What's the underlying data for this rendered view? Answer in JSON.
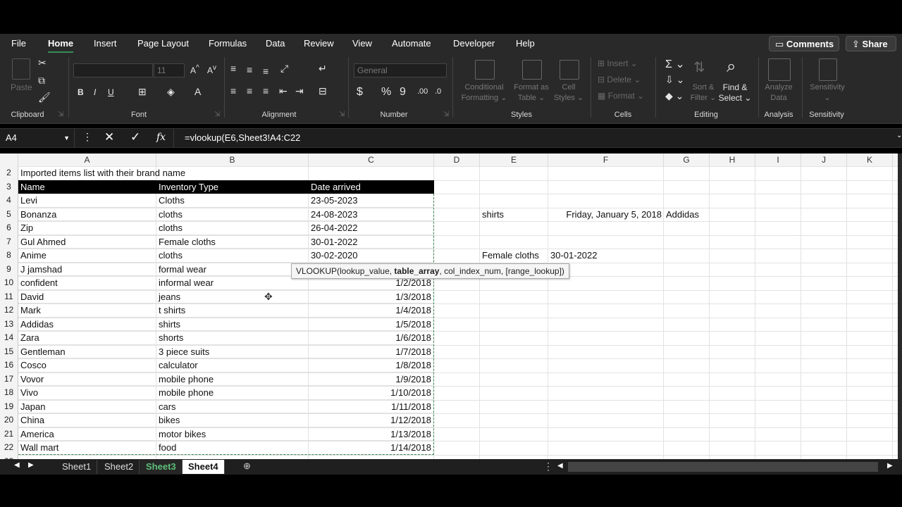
{
  "menu": {
    "items": [
      "File",
      "Home",
      "Insert",
      "Page Layout",
      "Formulas",
      "Data",
      "Review",
      "View",
      "Automate",
      "Developer",
      "Help"
    ],
    "active": "Home",
    "comments_label": "Comments",
    "share_label": "Share"
  },
  "ribbon": {
    "clipboard": {
      "label": "Clipboard",
      "paste": "Paste"
    },
    "font": {
      "label": "Font",
      "size": "11"
    },
    "alignment": {
      "label": "Alignment"
    },
    "number": {
      "label": "Number",
      "format": "General"
    },
    "styles": {
      "label": "Styles",
      "conditional_1": "Conditional",
      "conditional_2": "Formatting",
      "format_as_1": "Format as",
      "format_as_2": "Table",
      "cell_styles_1": "Cell",
      "cell_styles_2": "Styles"
    },
    "cells": {
      "label": "Cells",
      "insert": "Insert",
      "delete": "Delete",
      "format": "Format"
    },
    "editing": {
      "label": "Editing",
      "sort_1": "Sort &",
      "sort_2": "Filter",
      "find_1": "Find &",
      "find_2": "Select"
    },
    "analysis": {
      "label": "Analysis",
      "analyze_1": "Analyze",
      "analyze_2": "Data"
    },
    "sensitivity": {
      "label": "Sensitivity",
      "btn": "Sensitivity"
    }
  },
  "formula_bar": {
    "name_box": "A4",
    "formula": "=vlookup(E6,Sheet3!A4:C22",
    "fx": "fx"
  },
  "tooltip": {
    "prefix": "VLOOKUP(lookup_value, ",
    "bold": "table_array",
    "suffix": ", col_index_num, [range_lookup])"
  },
  "columns": [
    "A",
    "B",
    "C",
    "D",
    "E",
    "F",
    "G",
    "H",
    "I",
    "J",
    "K"
  ],
  "sheet": {
    "title": "Imported items list with their brand name",
    "headers": [
      "Name",
      "Inventory  Type",
      "Date arrived"
    ],
    "rows": [
      {
        "r": "4",
        "a": "Levi",
        "b": "Cloths",
        "c": "23-05-2023"
      },
      {
        "r": "5",
        "a": "Bonanza",
        "b": "cloths",
        "c": "24-08-2023"
      },
      {
        "r": "6",
        "a": "Zip",
        "b": "cloths",
        "c": "26-04-2022"
      },
      {
        "r": "7",
        "a": "Gul Ahmed",
        "b": "Female cloths",
        "c": "30-01-2022"
      },
      {
        "r": "8",
        "a": "Anime",
        "b": "cloths",
        "c": "30-02-2020"
      },
      {
        "r": "9",
        "a": "J jamshad",
        "b": " formal wear",
        "c": ""
      },
      {
        "r": "10",
        "a": "confident",
        "b": "informal wear",
        "c": "1/2/2018"
      },
      {
        "r": "11",
        "a": "David",
        "b": "jeans",
        "c": "1/3/2018"
      },
      {
        "r": "12",
        "a": "Mark",
        "b": "t shirts",
        "c": "1/4/2018"
      },
      {
        "r": "13",
        "a": "Addidas",
        "b": "shirts",
        "c": "1/5/2018"
      },
      {
        "r": "14",
        "a": "Zara",
        "b": "shorts",
        "c": "1/6/2018"
      },
      {
        "r": "15",
        "a": "Gentleman",
        "b": "3 piece suits",
        "c": "1/7/2018"
      },
      {
        "r": "16",
        "a": "Cosco",
        "b": "calculator",
        "c": "1/8/2018"
      },
      {
        "r": "17",
        "a": "Vovor",
        "b": "mobile phone",
        "c": "1/9/2018"
      },
      {
        "r": "18",
        "a": "Vivo",
        "b": "mobile phone",
        "c": "1/10/2018"
      },
      {
        "r": "19",
        "a": " Japan",
        "b": "cars",
        "c": "1/11/2018"
      },
      {
        "r": "20",
        "a": "China",
        "b": "bikes",
        "c": "1/12/2018"
      },
      {
        "r": "21",
        "a": "America",
        "b": "motor bikes",
        "c": "1/13/2018"
      },
      {
        "r": "22",
        "a": "Wall mart",
        "b": "food",
        "c": "1/14/2018"
      }
    ],
    "lookup": {
      "e5": "shirts",
      "f5": "Friday, January 5, 2018",
      "g5": "Addidas",
      "e8": "Female cloths",
      "f8": "30-01-2022"
    }
  },
  "tabs": [
    "Sheet1",
    "Sheet2",
    "Sheet3",
    "Sheet4"
  ],
  "active_tab": "Sheet3"
}
